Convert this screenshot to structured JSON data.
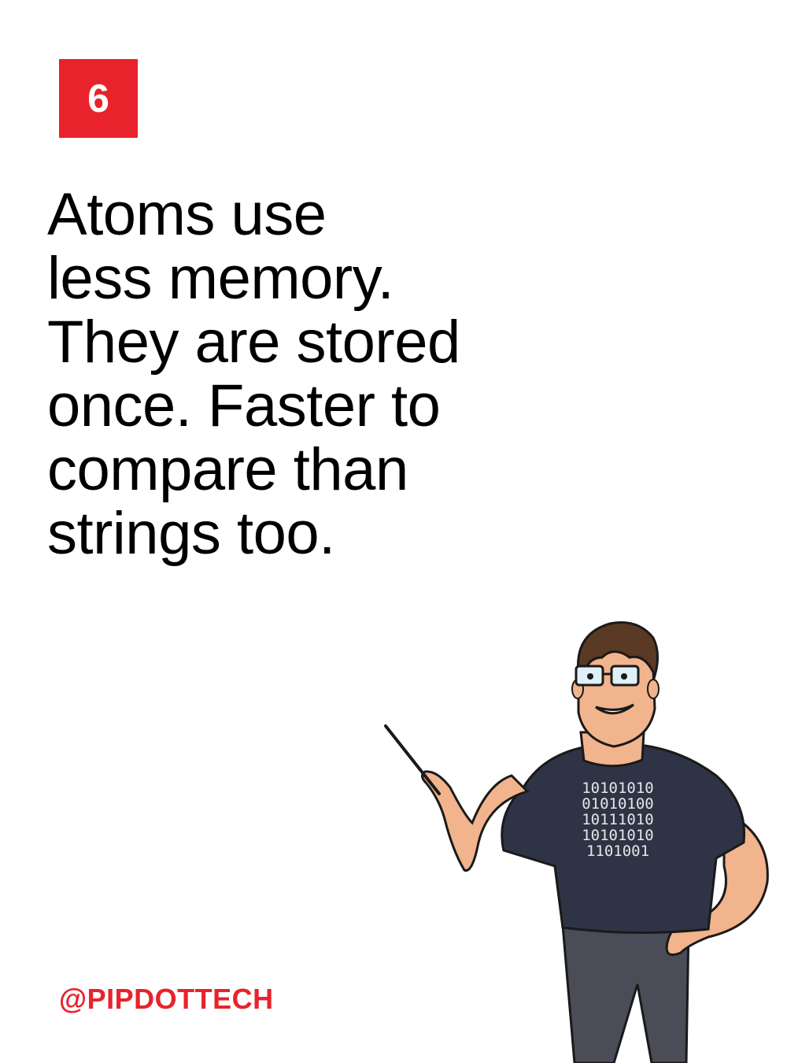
{
  "slide": {
    "number": "6",
    "headline_lines": [
      "Atoms use",
      "less memory.",
      "They are stored",
      "once. Faster to",
      "compare than",
      "strings too."
    ],
    "handle": "@PIPDOTTECH"
  },
  "illustration": {
    "shirt_binary_lines": [
      "10101010",
      "01010100",
      "10111010",
      "10101010",
      "1101001"
    ]
  },
  "colors": {
    "accent": "#e8232c",
    "text": "#000000",
    "background": "#ffffff",
    "shirt": "#2e3345",
    "skin": "#f2b48c",
    "hair": "#5a3a24",
    "pants": "#4a4d57"
  }
}
